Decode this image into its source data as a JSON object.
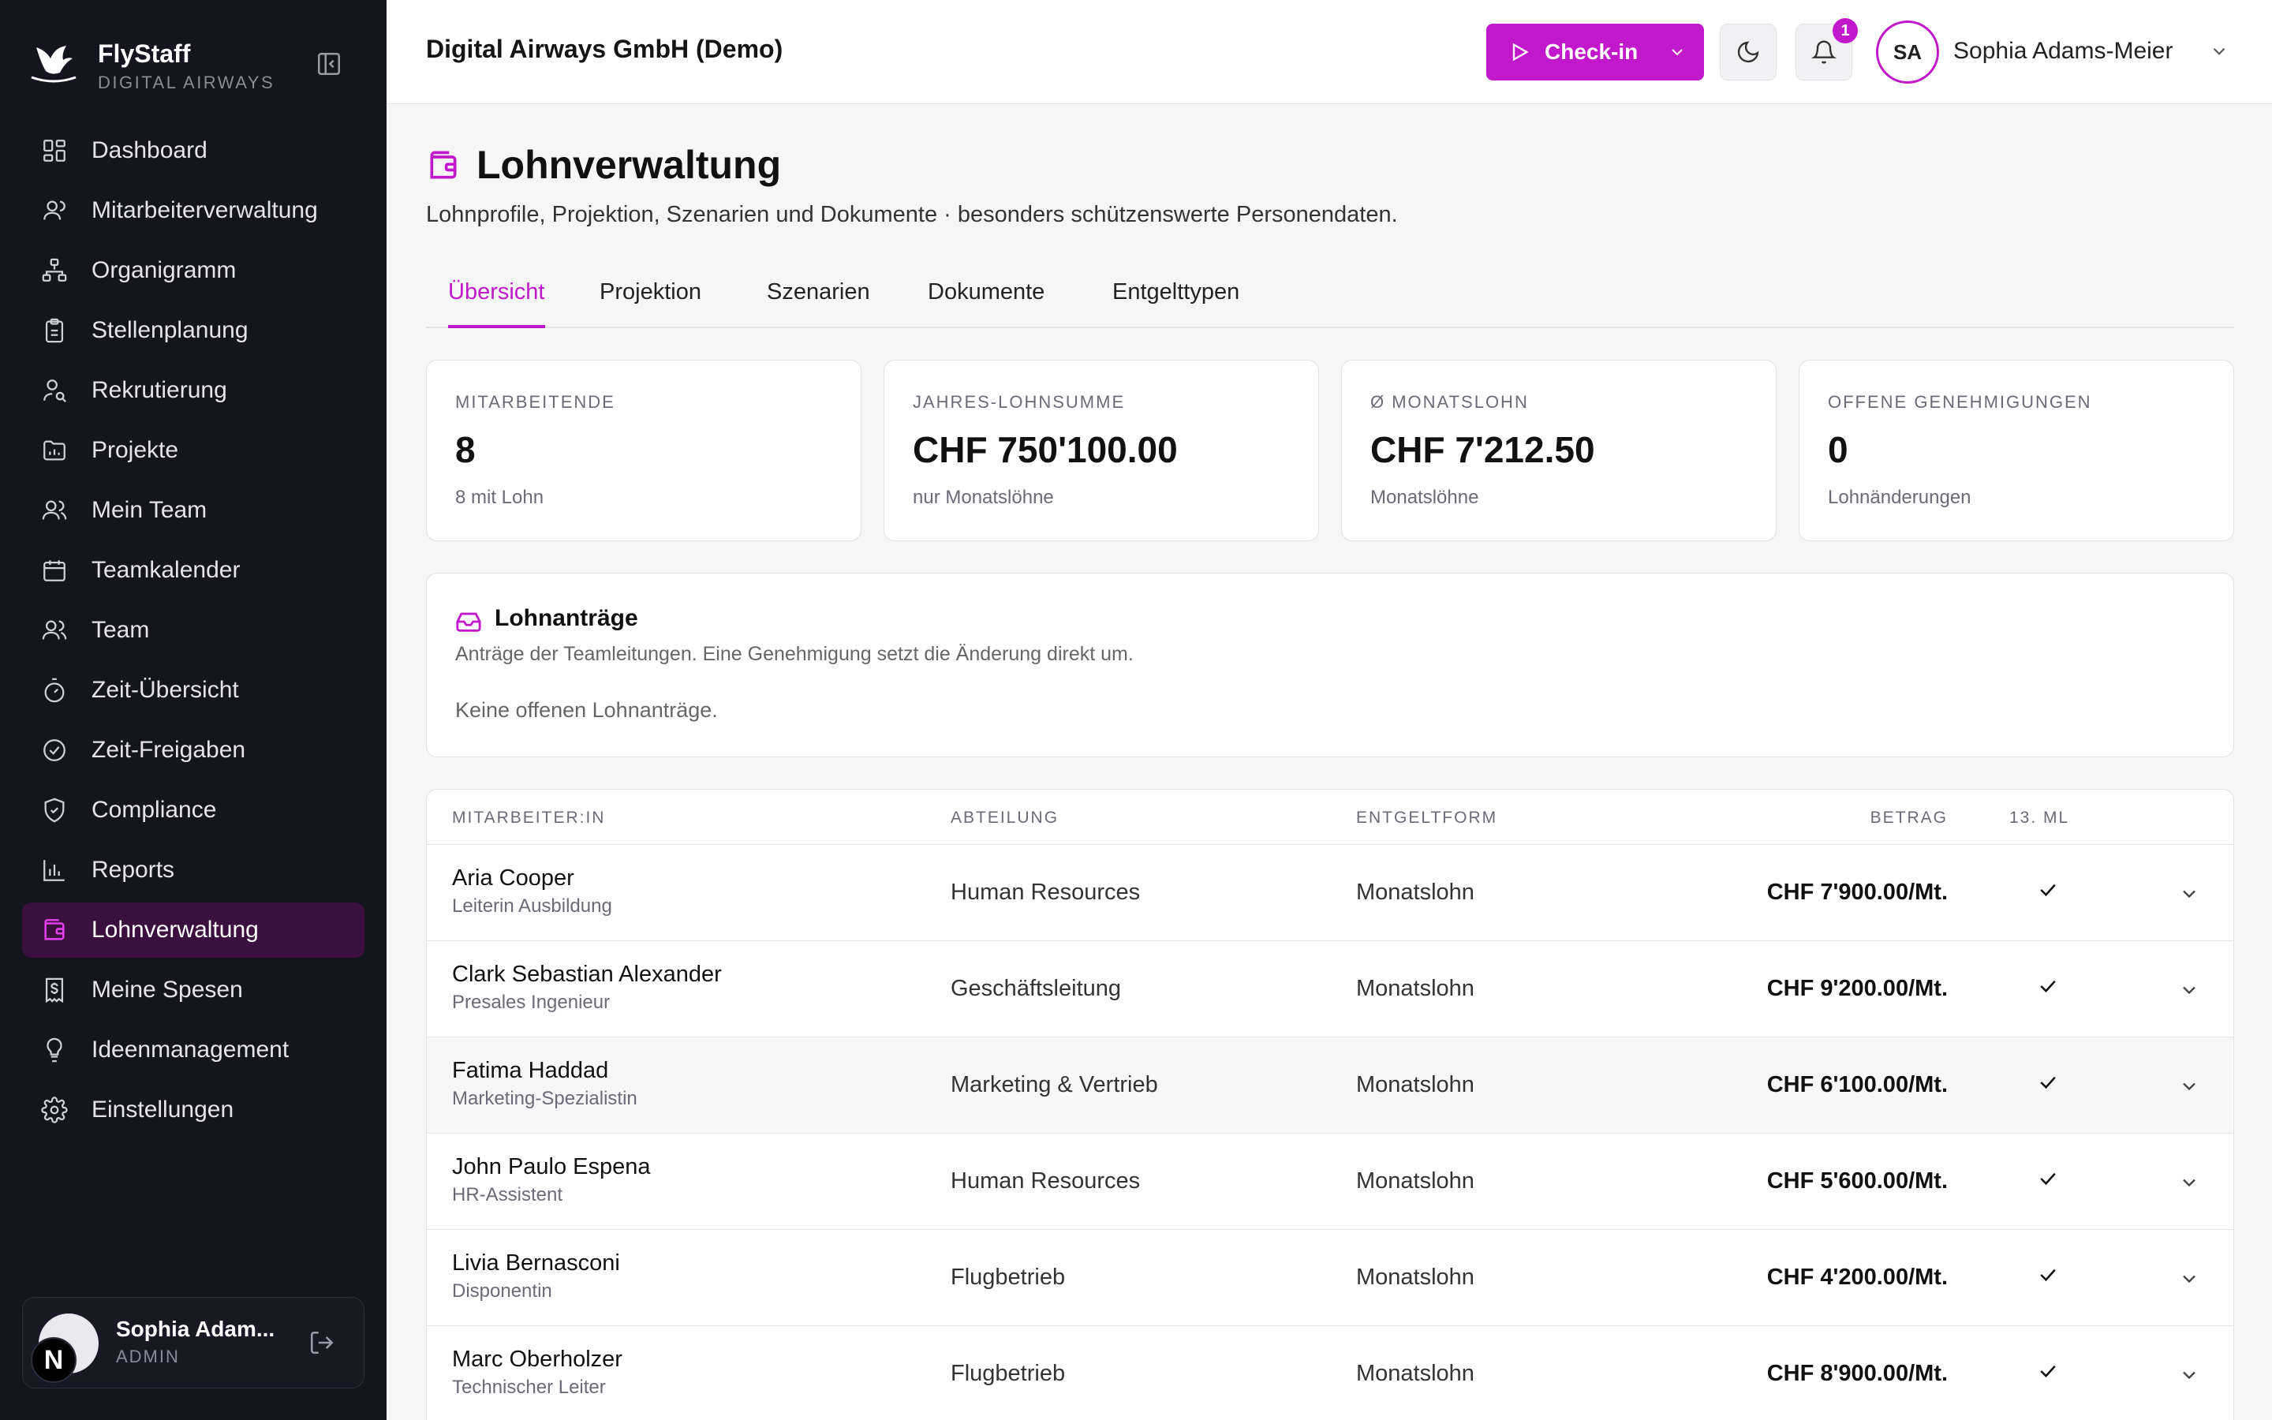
{
  "brand": {
    "name": "FlyStaff",
    "subtitle": "DIGITAL AIRWAYS"
  },
  "sidebar": {
    "items": [
      {
        "label": "Dashboard",
        "icon": "dashboard-icon"
      },
      {
        "label": "Mitarbeiterverwaltung",
        "icon": "user-icon"
      },
      {
        "label": "Organigramm",
        "icon": "org-chart-icon"
      },
      {
        "label": "Stellenplanung",
        "icon": "clipboard-icon"
      },
      {
        "label": "Rekrutierung",
        "icon": "user-search-icon"
      },
      {
        "label": "Projekte",
        "icon": "folder-chart-icon"
      },
      {
        "label": "Mein Team",
        "icon": "users-icon"
      },
      {
        "label": "Teamkalender",
        "icon": "calendar-icon"
      },
      {
        "label": "Team",
        "icon": "users-icon"
      },
      {
        "label": "Zeit-Übersicht",
        "icon": "timer-icon"
      },
      {
        "label": "Zeit-Freigaben",
        "icon": "check-circle-icon"
      },
      {
        "label": "Compliance",
        "icon": "shield-check-icon"
      },
      {
        "label": "Reports",
        "icon": "bar-chart-icon"
      },
      {
        "label": "Lohnverwaltung",
        "icon": "wallet-icon",
        "active": true
      },
      {
        "label": "Meine Spesen",
        "icon": "receipt-icon"
      },
      {
        "label": "Ideenmanagement",
        "icon": "lightbulb-icon"
      },
      {
        "label": "Einstellungen",
        "icon": "settings-icon"
      }
    ],
    "user": {
      "name": "Sophia Adam...",
      "role": "ADMIN",
      "avatar_letter": "N"
    }
  },
  "topbar": {
    "company": "Digital Airways GmbH (Demo)",
    "checkin_label": "Check-in",
    "notification_count": "1",
    "avatar_initials": "SA",
    "user_name": "Sophia Adams-Meier"
  },
  "page": {
    "title": "Lohnverwaltung",
    "subtitle": "Lohnprofile, Projektion, Szenarien und Dokumente · besonders schützenswerte Personendaten."
  },
  "tabs": [
    {
      "label": "Übersicht",
      "active": true
    },
    {
      "label": "Projektion"
    },
    {
      "label": "Szenarien"
    },
    {
      "label": "Dokumente"
    },
    {
      "label": "Entgelttypen"
    }
  ],
  "kpis": [
    {
      "label": "MITARBEITENDE",
      "value": "8",
      "sub": "8 mit Lohn"
    },
    {
      "label": "JAHRES-LOHNSUMME",
      "value": "CHF 750'100.00",
      "sub": "nur Monatslöhne"
    },
    {
      "label": "Ø MONATSLOHN",
      "value": "CHF 7'212.50",
      "sub": "Monatslöhne"
    },
    {
      "label": "OFFENE GENEHMIGUNGEN",
      "value": "0",
      "sub": "Lohnänderungen"
    }
  ],
  "requests": {
    "title": "Lohnanträge",
    "subtitle": "Anträge der Teamleitungen. Eine Genehmigung setzt die Änderung direkt um.",
    "empty": "Keine offenen Lohnanträge."
  },
  "table": {
    "headers": {
      "name": "MITARBEITER:IN",
      "dept": "ABTEILUNG",
      "form": "ENTGELTFORM",
      "amount": "BETRAG",
      "ml": "13. ML"
    },
    "rows": [
      {
        "name": "Aria Cooper",
        "role": "Leiterin Ausbildung",
        "dept": "Human Resources",
        "form": "Monatslohn",
        "amount": "CHF 7'900.00/Mt."
      },
      {
        "name": "Clark Sebastian Alexander",
        "role": "Presales Ingenieur",
        "dept": "Geschäftsleitung",
        "form": "Monatslohn",
        "amount": "CHF 9'200.00/Mt."
      },
      {
        "name": "Fatima Haddad",
        "role": "Marketing-Spezialistin",
        "dept": "Marketing & Vertrieb",
        "form": "Monatslohn",
        "amount": "CHF 6'100.00/Mt."
      },
      {
        "name": "John Paulo Espena",
        "role": "HR-Assistent",
        "dept": "Human Resources",
        "form": "Monatslohn",
        "amount": "CHF 5'600.00/Mt."
      },
      {
        "name": "Livia Bernasconi",
        "role": "Disponentin",
        "dept": "Flugbetrieb",
        "form": "Monatslohn",
        "amount": "CHF 4'200.00/Mt."
      },
      {
        "name": "Marc Oberholzer",
        "role": "Technischer Leiter",
        "dept": "Flugbetrieb",
        "form": "Monatslohn",
        "amount": "CHF 8'900.00/Mt."
      }
    ]
  },
  "colors": {
    "accent": "#c218cc",
    "sidebar_bg": "#14151f",
    "active_nav_bg": "#3b0f3e"
  }
}
